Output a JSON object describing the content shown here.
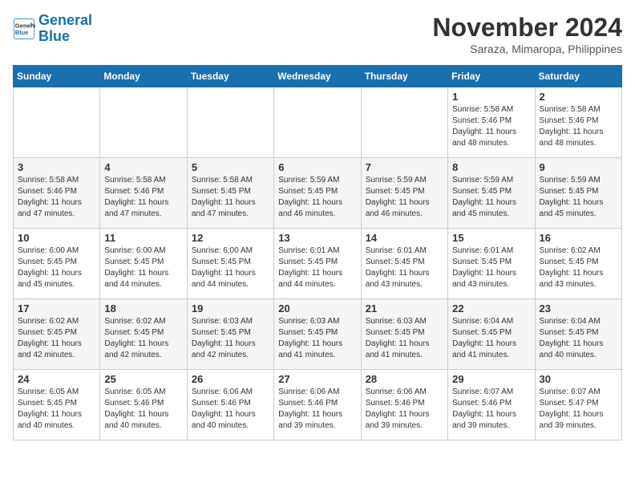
{
  "logo": {
    "line1": "General",
    "line2": "Blue"
  },
  "title": "November 2024",
  "location": "Saraza, Mimaropa, Philippines",
  "weekdays": [
    "Sunday",
    "Monday",
    "Tuesday",
    "Wednesday",
    "Thursday",
    "Friday",
    "Saturday"
  ],
  "weeks": [
    [
      {
        "day": "",
        "info": ""
      },
      {
        "day": "",
        "info": ""
      },
      {
        "day": "",
        "info": ""
      },
      {
        "day": "",
        "info": ""
      },
      {
        "day": "",
        "info": ""
      },
      {
        "day": "1",
        "info": "Sunrise: 5:58 AM\nSunset: 5:46 PM\nDaylight: 11 hours\nand 48 minutes."
      },
      {
        "day": "2",
        "info": "Sunrise: 5:58 AM\nSunset: 5:46 PM\nDaylight: 11 hours\nand 48 minutes."
      }
    ],
    [
      {
        "day": "3",
        "info": "Sunrise: 5:58 AM\nSunset: 5:46 PM\nDaylight: 11 hours\nand 47 minutes."
      },
      {
        "day": "4",
        "info": "Sunrise: 5:58 AM\nSunset: 5:46 PM\nDaylight: 11 hours\nand 47 minutes."
      },
      {
        "day": "5",
        "info": "Sunrise: 5:58 AM\nSunset: 5:45 PM\nDaylight: 11 hours\nand 47 minutes."
      },
      {
        "day": "6",
        "info": "Sunrise: 5:59 AM\nSunset: 5:45 PM\nDaylight: 11 hours\nand 46 minutes."
      },
      {
        "day": "7",
        "info": "Sunrise: 5:59 AM\nSunset: 5:45 PM\nDaylight: 11 hours\nand 46 minutes."
      },
      {
        "day": "8",
        "info": "Sunrise: 5:59 AM\nSunset: 5:45 PM\nDaylight: 11 hours\nand 45 minutes."
      },
      {
        "day": "9",
        "info": "Sunrise: 5:59 AM\nSunset: 5:45 PM\nDaylight: 11 hours\nand 45 minutes."
      }
    ],
    [
      {
        "day": "10",
        "info": "Sunrise: 6:00 AM\nSunset: 5:45 PM\nDaylight: 11 hours\nand 45 minutes."
      },
      {
        "day": "11",
        "info": "Sunrise: 6:00 AM\nSunset: 5:45 PM\nDaylight: 11 hours\nand 44 minutes."
      },
      {
        "day": "12",
        "info": "Sunrise: 6:00 AM\nSunset: 5:45 PM\nDaylight: 11 hours\nand 44 minutes."
      },
      {
        "day": "13",
        "info": "Sunrise: 6:01 AM\nSunset: 5:45 PM\nDaylight: 11 hours\nand 44 minutes."
      },
      {
        "day": "14",
        "info": "Sunrise: 6:01 AM\nSunset: 5:45 PM\nDaylight: 11 hours\nand 43 minutes."
      },
      {
        "day": "15",
        "info": "Sunrise: 6:01 AM\nSunset: 5:45 PM\nDaylight: 11 hours\nand 43 minutes."
      },
      {
        "day": "16",
        "info": "Sunrise: 6:02 AM\nSunset: 5:45 PM\nDaylight: 11 hours\nand 43 minutes."
      }
    ],
    [
      {
        "day": "17",
        "info": "Sunrise: 6:02 AM\nSunset: 5:45 PM\nDaylight: 11 hours\nand 42 minutes."
      },
      {
        "day": "18",
        "info": "Sunrise: 6:02 AM\nSunset: 5:45 PM\nDaylight: 11 hours\nand 42 minutes."
      },
      {
        "day": "19",
        "info": "Sunrise: 6:03 AM\nSunset: 5:45 PM\nDaylight: 11 hours\nand 42 minutes."
      },
      {
        "day": "20",
        "info": "Sunrise: 6:03 AM\nSunset: 5:45 PM\nDaylight: 11 hours\nand 41 minutes."
      },
      {
        "day": "21",
        "info": "Sunrise: 6:03 AM\nSunset: 5:45 PM\nDaylight: 11 hours\nand 41 minutes."
      },
      {
        "day": "22",
        "info": "Sunrise: 6:04 AM\nSunset: 5:45 PM\nDaylight: 11 hours\nand 41 minutes."
      },
      {
        "day": "23",
        "info": "Sunrise: 6:04 AM\nSunset: 5:45 PM\nDaylight: 11 hours\nand 40 minutes."
      }
    ],
    [
      {
        "day": "24",
        "info": "Sunrise: 6:05 AM\nSunset: 5:45 PM\nDaylight: 11 hours\nand 40 minutes."
      },
      {
        "day": "25",
        "info": "Sunrise: 6:05 AM\nSunset: 5:46 PM\nDaylight: 11 hours\nand 40 minutes."
      },
      {
        "day": "26",
        "info": "Sunrise: 6:06 AM\nSunset: 5:46 PM\nDaylight: 11 hours\nand 40 minutes."
      },
      {
        "day": "27",
        "info": "Sunrise: 6:06 AM\nSunset: 5:46 PM\nDaylight: 11 hours\nand 39 minutes."
      },
      {
        "day": "28",
        "info": "Sunrise: 6:06 AM\nSunset: 5:46 PM\nDaylight: 11 hours\nand 39 minutes."
      },
      {
        "day": "29",
        "info": "Sunrise: 6:07 AM\nSunset: 5:46 PM\nDaylight: 11 hours\nand 39 minutes."
      },
      {
        "day": "30",
        "info": "Sunrise: 6:07 AM\nSunset: 5:47 PM\nDaylight: 11 hours\nand 39 minutes."
      }
    ]
  ]
}
